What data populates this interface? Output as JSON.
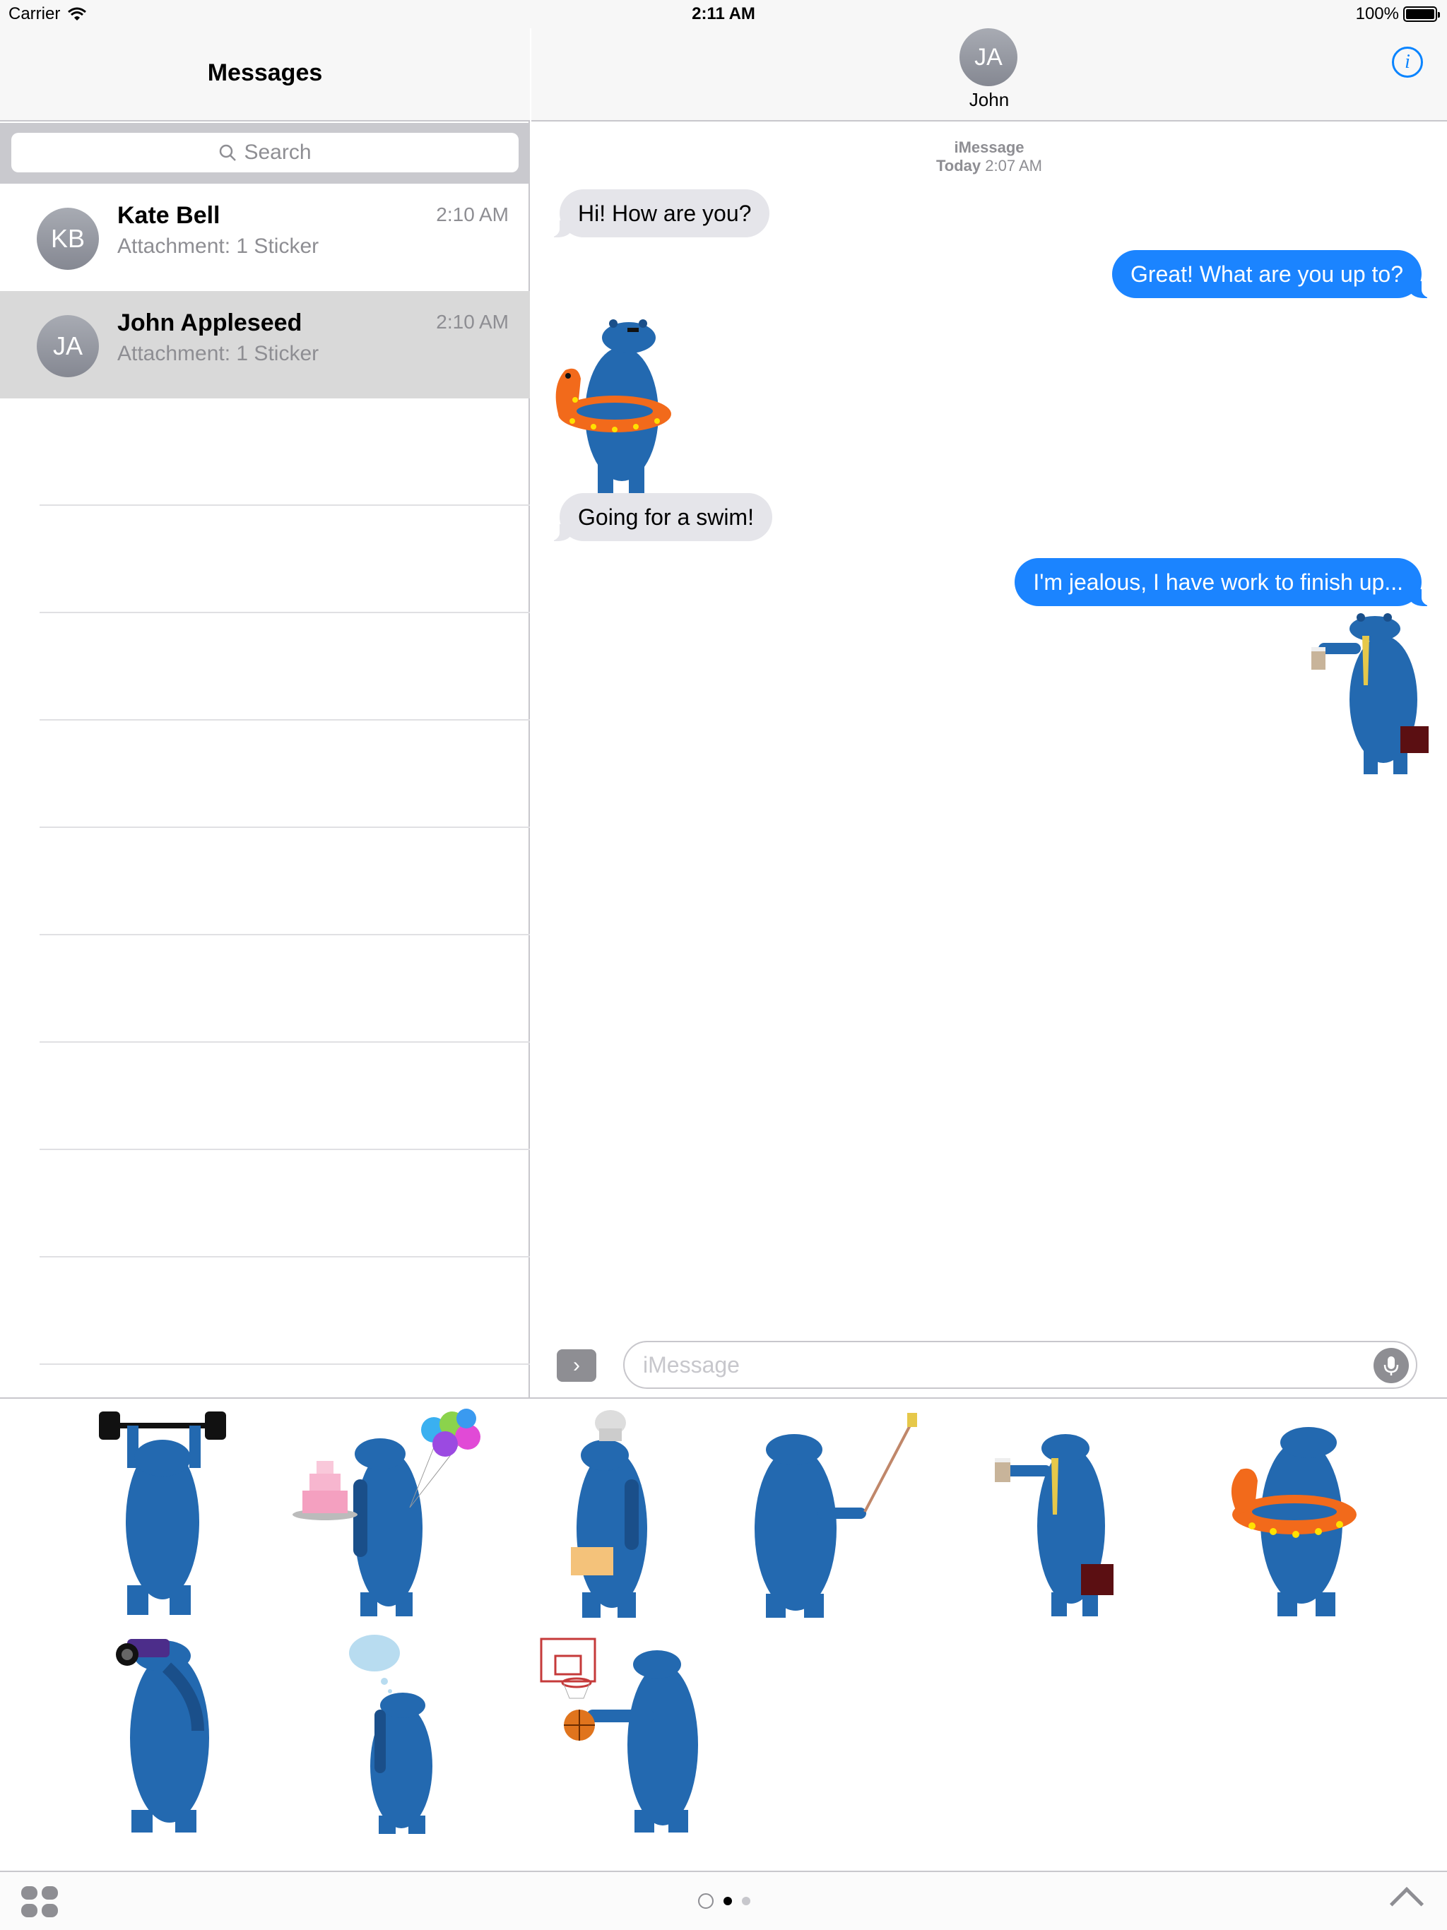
{
  "status": {
    "carrier": "Carrier",
    "time": "2:11 AM",
    "battery": "100%"
  },
  "sidebar": {
    "title": "Messages",
    "search_placeholder": "Search",
    "conversations": [
      {
        "initials": "KB",
        "name": "Kate Bell",
        "preview": "Attachment: 1 Sticker",
        "time": "2:10 AM",
        "selected": false
      },
      {
        "initials": "JA",
        "name": "John Appleseed",
        "preview": "Attachment: 1 Sticker",
        "time": "2:10 AM",
        "selected": true
      }
    ]
  },
  "chat": {
    "contact_initials": "JA",
    "contact_name": "John",
    "service": "iMessage",
    "date_prefix": "Today",
    "date_time": "2:07 AM",
    "messages": [
      {
        "dir": "in",
        "text": "Hi! How are you?"
      },
      {
        "dir": "out",
        "text": "Great! What are you up to?"
      },
      {
        "dir": "in",
        "sticker": "swim-ring-bear"
      },
      {
        "dir": "in",
        "text": "Going for a swim!"
      },
      {
        "dir": "out",
        "text": "I'm jealous, I have work to finish up..."
      },
      {
        "dir": "out",
        "sticker": "businessman-bear"
      }
    ],
    "input_placeholder": "iMessage"
  },
  "drawer": {
    "stickers": [
      "weightlifting-bear",
      "birthday-bear",
      "chef-bear",
      "selfie-bear",
      "businessman-bear",
      "swim-ring-bear",
      "binoculars-bear",
      "thinking-bear",
      "basketball-bear"
    ],
    "page_count": 2,
    "active_page": 1
  },
  "colors": {
    "bear": "#2369b0",
    "bear_dark": "#1a4f8a",
    "bubble_out": "#1b84ff",
    "bubble_in": "#e5e5ea"
  }
}
